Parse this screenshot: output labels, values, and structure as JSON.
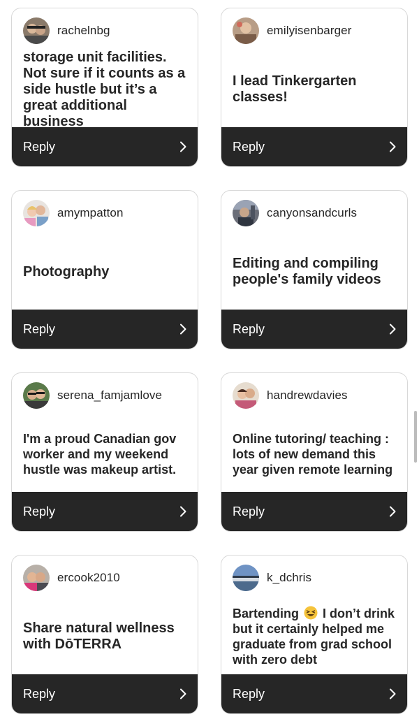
{
  "reply_label": "Reply",
  "cards": [
    {
      "username": "rachelnbg",
      "comment": "storage unit facilities. Not sure if it counts as a side hustle but it’s a great additional business",
      "avatar_icon": "user-avatar-icon"
    },
    {
      "username": "emilyisenbarger",
      "comment": "I lead Tinkergarten classes!",
      "avatar_icon": "user-avatar-icon"
    },
    {
      "username": "amympatton",
      "comment": "Photography",
      "avatar_icon": "user-avatar-icon"
    },
    {
      "username": "canyonsandcurls",
      "comment": "Editing and compiling people's family videos",
      "avatar_icon": "user-avatar-icon"
    },
    {
      "username": "serena_famjamlove",
      "comment": "I'm a proud Canadian gov worker and my weekend hustle was makeup artist.",
      "avatar_icon": "user-avatar-icon"
    },
    {
      "username": "handrewdavies",
      "comment": "Online tutoring/ teaching : lots of new demand this year given remote learning",
      "avatar_icon": "user-avatar-icon"
    },
    {
      "username": "ercook2010",
      "comment": "Share natural wellness with DōTERRA",
      "avatar_icon": "user-avatar-icon"
    },
    {
      "username": "k_dchris",
      "comment_before_emoji": "Bartending",
      "emoji_icon": "laughing-face-emoji-icon",
      "comment_after_emoji": "I don’t drink but it certainly helped me graduate from grad school with zero debt",
      "avatar_icon": "user-avatar-icon"
    }
  ],
  "colors": {
    "reply_bar": "#262626",
    "text": "#262626",
    "card_border": "#d8d8d8"
  }
}
